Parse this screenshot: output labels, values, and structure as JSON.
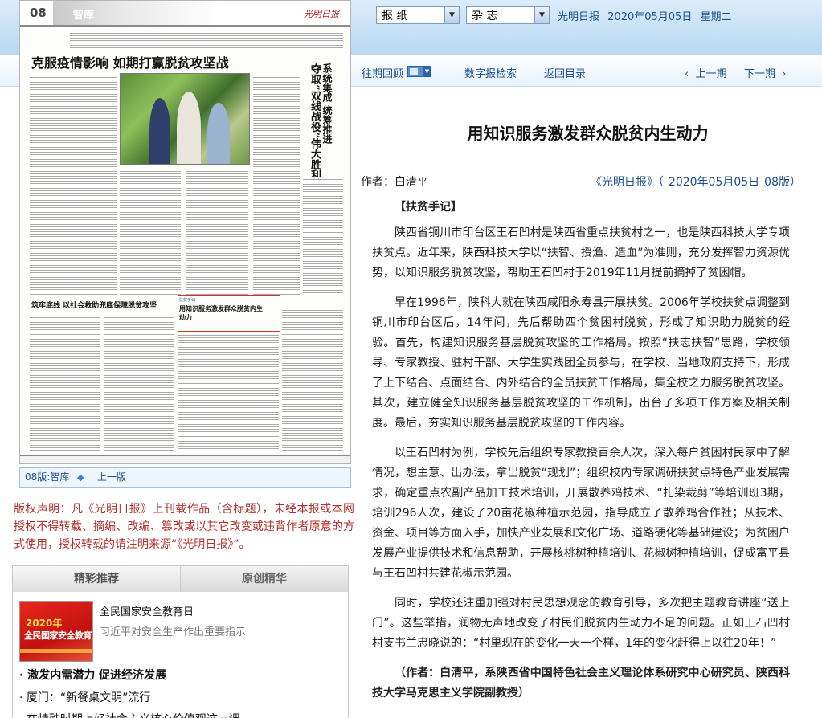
{
  "header": {
    "select_newspaper": "报  纸",
    "select_magazine": "杂  志",
    "paper_name": "光明日报",
    "date": "2020年05月05日",
    "weekday": "星期二"
  },
  "nav": {
    "archive": "往期回顾",
    "digital_search": "数字报检索",
    "back_to_toc": "返回目录",
    "prev_issue": "上一期",
    "next_issue": "下一期"
  },
  "newspaper_page": {
    "page_number": "08",
    "section": "智库",
    "masthead": "光明日报",
    "headline_main": "克服疫情影响  如期打赢脱贫攻坚战",
    "headline_vertical_1": "系统集成  统筹推进",
    "headline_vertical_2": "夺取“双线战役”伟大胜利",
    "headline_lower": "筑牢底线  以社会救助兜底保障脱贫攻坚",
    "column_tag": "扶贫手记",
    "headline_featured": "用知识服务激发群众脱贫内生动力"
  },
  "page_bar": {
    "page_label": "08版:智库",
    "prev_page": "上一版"
  },
  "copyright": "版权声明：凡《光明日报》上刊载作品（含标题），未经本报或本网授权不得转载、摘编、改编、篡改或以其它改变或违背作者原意的方式使用，授权转载的请注明来源“《光明日报》”。",
  "recommend": {
    "tab_featured": "精彩推荐",
    "tab_original": "原创精华",
    "thumb_year": "2020年",
    "thumb_text": "全民国家安全教育日",
    "featured_title": "全民国家安全教育日",
    "featured_desc": "习近平对安全生产作出重要指示",
    "items": [
      "· 激发内需潜力  促进经济发展",
      "· 厦门：“新餐桌文明”流行",
      "· 在特殊时期上好社会主义核心价值观这一课"
    ]
  },
  "article": {
    "title": "用知识服务激发群众脱贫内生动力",
    "author": "作者：白清平",
    "source": "《光明日报》（",
    "source_date": "2020年05月05日",
    "source_page": "08版）",
    "section_label": "【扶贫手记】",
    "paragraphs": [
      "陕西省铜川市印台区王石凹村是陕西省重点扶贫村之一，也是陕西科技大学专项扶贫点。近年来，陕西科技大学以“扶智、授渔、造血”为准则，充分发挥智力资源优势，以知识服务脱贫攻坚，帮助王石凹村于2019年11月提前摘掉了贫困帽。",
      "早在1996年，陕科大就在陕西咸阳永寿县开展扶贫。2006年学校扶贫点调整到铜川市印台区后，14年间，先后帮助四个贫困村脱贫，形成了知识助力脱贫的经验。首先，构建知识服务基层脱贫攻坚的工作格局。按照“扶志扶智”思路，学校领导、专家教授、驻村干部、大学生实践团全员参与，在学校、当地政府支持下，形成了上下结合、点面结合、内外结合的全员扶贫工作格局，集全校之力服务脱贫攻坚。其次，建立健全知识服务基层脱贫攻坚的工作机制，出台了多项工作方案及相关制度。最后，夯实知识服务基层脱贫攻坚的工作内容。",
      "以王石凹村为例，学校先后组织专家教授百余人次，深入每户贫困村民家中了解情况，想主意、出办法，拿出脱贫“规划”；组织校内专家调研扶贫点特色产业发展需求，确定重点农副产品加工技术培训，开展散养鸡技术、“扎染裁剪”等培训班3期，培训296人次，建设了20亩花椒种植示范园，指导成立了散养鸡合作社；从技术、资金、项目等方面入手，加快产业发展和文化广场、道路硬化等基础建设；为贫困户发展产业提供技术和信息帮助，开展核桃树种植培训、花椒树种植培训，促成富平县与王石凹村共建花椒示范园。",
      "同时，学校还注重加强对村民思想观念的教育引导，多次把主题教育讲座“送上门”。这些举措，润物无声地改变了村民们脱贫内生动力不足的问题。正如王石凹村村支书兰忠晓说的：“村里现在的变化一天一个样，1年的变化赶得上以往20年！”"
    ],
    "signature": "（作者：白清平，系陕西省中国特色社会主义理论体系研究中心研究员、陕西科技大学马克思主义学院副教授）"
  },
  "colors": {
    "link_blue": "#1a4f8f",
    "copyright_red": "#b3302a",
    "header_blue": "#b9d8f3"
  }
}
